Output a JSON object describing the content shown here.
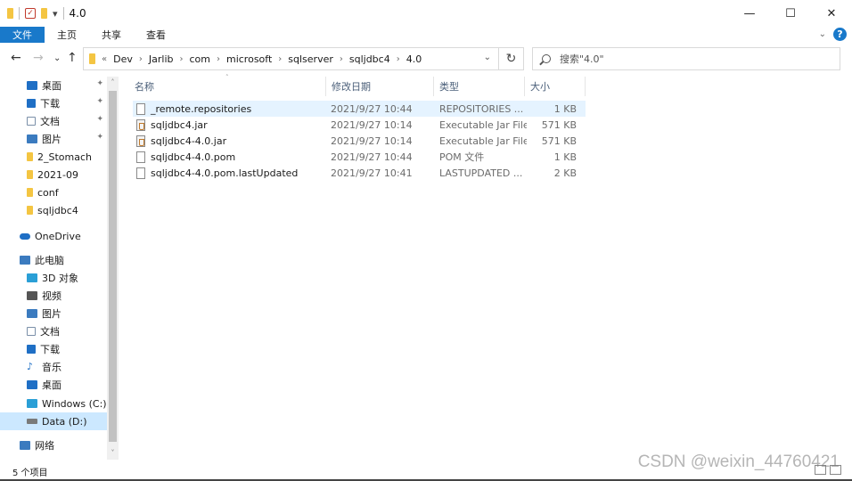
{
  "window": {
    "title": "4.0",
    "controls": {
      "minimize": "—",
      "maximize": "☐",
      "close": "✕"
    },
    "quick_access_dropdown": "▾"
  },
  "ribbon": {
    "tabs": [
      "文件",
      "主页",
      "共享",
      "查看"
    ],
    "help": "?",
    "collapse": "⌄"
  },
  "nav": {
    "back": "←",
    "forward": "→",
    "recent": "⌄",
    "up": "↑",
    "refresh": "↻",
    "breadcrumb_prefix": "«",
    "breadcrumb": [
      "Dev",
      "Jarlib",
      "com",
      "microsoft",
      "sqlserver",
      "sqljdbc4",
      "4.0"
    ],
    "search_placeholder": "搜索\"4.0\""
  },
  "sidebar": {
    "items": [
      {
        "label": "桌面",
        "icon": "desktop-icon",
        "color": "#1f6fc5",
        "pinned": true
      },
      {
        "label": "下载",
        "icon": "download-icon",
        "color": "#1f6fc5",
        "pinned": true
      },
      {
        "label": "文档",
        "icon": "document-icon",
        "color": "#7a8fa8",
        "pinned": true
      },
      {
        "label": "图片",
        "icon": "pictures-icon",
        "color": "#3b7bbf",
        "pinned": true
      },
      {
        "label": "2_Stomach",
        "icon": "folder-icon",
        "color": "#f4c542",
        "pinned": false
      },
      {
        "label": "2021-09",
        "icon": "folder-icon",
        "color": "#f4c542",
        "pinned": false
      },
      {
        "label": "conf",
        "icon": "folder-icon",
        "color": "#f4c542",
        "pinned": false
      },
      {
        "label": "sqljdbc4",
        "icon": "folder-icon",
        "color": "#f4c542",
        "pinned": false
      },
      {
        "label": "OneDrive",
        "icon": "onedrive-icon",
        "color": "#1f6fc5",
        "pinned": false
      },
      {
        "label": "此电脑",
        "icon": "this-pc-icon",
        "color": "#3b7bbf",
        "pinned": false
      },
      {
        "label": "3D 对象",
        "icon": "3d-objects-icon",
        "color": "#2a9fd6",
        "pinned": false
      },
      {
        "label": "视频",
        "icon": "videos-icon",
        "color": "#555555",
        "pinned": false
      },
      {
        "label": "图片",
        "icon": "pictures-icon",
        "color": "#3b7bbf",
        "pinned": false
      },
      {
        "label": "文档",
        "icon": "document-icon",
        "color": "#7a8fa8",
        "pinned": false
      },
      {
        "label": "下载",
        "icon": "download-icon",
        "color": "#1f6fc5",
        "pinned": false
      },
      {
        "label": "音乐",
        "icon": "music-icon",
        "color": "#1f6fc5",
        "pinned": false
      },
      {
        "label": "桌面",
        "icon": "desktop-icon",
        "color": "#1f6fc5",
        "pinned": false
      },
      {
        "label": "Windows (C:)",
        "icon": "windows-drive-icon",
        "color": "#2a9fd6",
        "pinned": false
      },
      {
        "label": "Data (D:)",
        "icon": "drive-icon",
        "color": "#7a7a7a",
        "pinned": false
      },
      {
        "label": "网络",
        "icon": "network-icon",
        "color": "#3b7bbf",
        "pinned": false
      }
    ],
    "pin_glyph": "📌",
    "scroll_up": "˄",
    "scroll_down": "˅"
  },
  "columns": {
    "name": "名称",
    "modified": "修改日期",
    "type": "类型",
    "size": "大小",
    "sort_indicator": "˄"
  },
  "files": [
    {
      "name": "_remote.repositories",
      "modified": "2021/9/27 10:44",
      "type": "REPOSITORIES ...",
      "size": "1 KB",
      "icon": "file-icon"
    },
    {
      "name": "sqljdbc4.jar",
      "modified": "2021/9/27 10:14",
      "type": "Executable Jar File",
      "size": "571 KB",
      "icon": "jar-icon"
    },
    {
      "name": "sqljdbc4-4.0.jar",
      "modified": "2021/9/27 10:14",
      "type": "Executable Jar File",
      "size": "571 KB",
      "icon": "jar-icon"
    },
    {
      "name": "sqljdbc4-4.0.pom",
      "modified": "2021/9/27 10:44",
      "type": "POM 文件",
      "size": "1 KB",
      "icon": "file-icon"
    },
    {
      "name": "sqljdbc4-4.0.pom.lastUpdated",
      "modified": "2021/9/27 10:41",
      "type": "LASTUPDATED ...",
      "size": "2 KB",
      "icon": "file-icon"
    }
  ],
  "status": {
    "count": "5 个项目"
  },
  "watermark": "CSDN @weixin_44760421",
  "colors": {
    "accent": "#1979ca",
    "hover_row": "#e5f3ff",
    "selected_nav": "#cce8ff"
  }
}
